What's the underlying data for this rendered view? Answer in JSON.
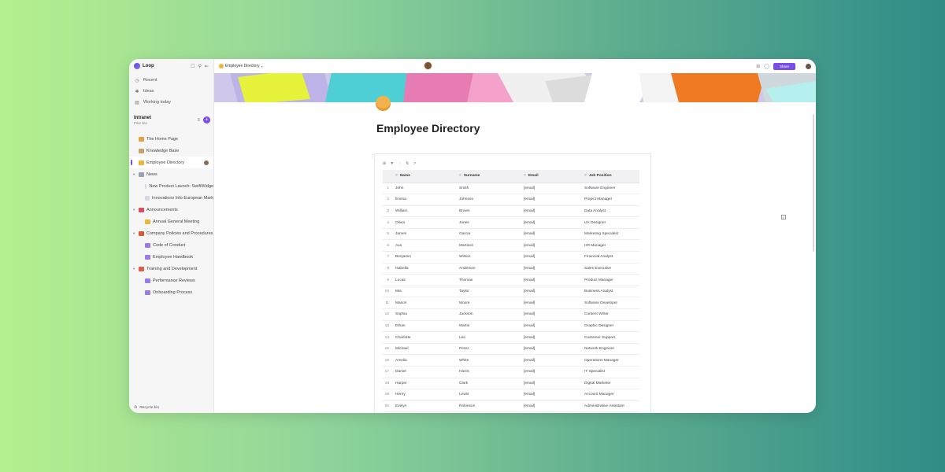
{
  "app": {
    "name": "Loop"
  },
  "sidebar": {
    "nav": [
      {
        "label": "Recent",
        "icon": "clock-icon"
      },
      {
        "label": "Ideas",
        "icon": "lightbulb-icon"
      },
      {
        "label": "Working today",
        "icon": "briefcase-icon"
      }
    ],
    "workspace": {
      "name": "Intranet",
      "sub": "Pilot site"
    },
    "tree": [
      {
        "label": "The Home Page",
        "level": 0,
        "kind": "page",
        "color": "#e2a34a"
      },
      {
        "label": "Knowledge Base",
        "level": 0,
        "kind": "page",
        "color": "#c7a26b"
      },
      {
        "label": "Employee Directory",
        "level": 0,
        "kind": "page",
        "active": true,
        "color": "#f0b43a"
      },
      {
        "label": "News",
        "level": 0,
        "kind": "group",
        "color": "#9aa0b5"
      },
      {
        "label": "New Product Launch: SwiftWidge",
        "level": 1,
        "kind": "page",
        "color": "#d6d6e6"
      },
      {
        "label": "Innovations Into European Mark",
        "level": 1,
        "kind": "page",
        "color": "#d6d6e6"
      },
      {
        "label": "Announcements",
        "level": 0,
        "kind": "group",
        "color": "#d84b64"
      },
      {
        "label": "Annual General Meeting",
        "level": 1,
        "kind": "page",
        "color": "#f0b43a"
      },
      {
        "label": "Company Policies and Procedures",
        "level": 0,
        "kind": "group",
        "color": "#d65a3a"
      },
      {
        "label": "Code of Conduct",
        "level": 1,
        "kind": "page",
        "color": "#9c7be6"
      },
      {
        "label": "Employee Handbook",
        "level": 1,
        "kind": "page",
        "color": "#9c7be6"
      },
      {
        "label": "Training and Development",
        "level": 0,
        "kind": "group",
        "color": "#e25b4b"
      },
      {
        "label": "Performance Reviews",
        "level": 1,
        "kind": "page",
        "color": "#9c7be6"
      },
      {
        "label": "Onboarding Process",
        "level": 1,
        "kind": "page",
        "color": "#9c7be6"
      }
    ],
    "bottom": {
      "label": "Recycle bin",
      "icon": "recycle-bin-icon"
    }
  },
  "topbar": {
    "breadcrumb": "Employee Directory",
    "share_label": "Share"
  },
  "page": {
    "title": "Employee Directory"
  },
  "table": {
    "columns": [
      "Name",
      "Surname",
      "Email",
      "Job Position"
    ],
    "rows": [
      [
        "1",
        "John",
        "Smith",
        "[email]",
        "Software Engineer"
      ],
      [
        "2",
        "Emma",
        "Johnson",
        "[email]",
        "Project Manager"
      ],
      [
        "3",
        "William",
        "Brown",
        "[email]",
        "Data Analyst"
      ],
      [
        "4",
        "Olivia",
        "Jones",
        "[email]",
        "UX Designer"
      ],
      [
        "5",
        "James",
        "Garcia",
        "[email]",
        "Marketing Specialist"
      ],
      [
        "6",
        "Ava",
        "Martinez",
        "[email]",
        "HR Manager"
      ],
      [
        "7",
        "Benjamin",
        "Wilson",
        "[email]",
        "Financial Analyst"
      ],
      [
        "8",
        "Isabella",
        "Anderson",
        "[email]",
        "Sales Executive"
      ],
      [
        "9",
        "Lucas",
        "Thomas",
        "[email]",
        "Product Manager"
      ],
      [
        "10",
        "Mia",
        "Taylor",
        "[email]",
        "Business Analyst"
      ],
      [
        "11",
        "Mason",
        "Moore",
        "[email]",
        "Software Developer"
      ],
      [
        "12",
        "Sophia",
        "Jackson",
        "[email]",
        "Content Writer"
      ],
      [
        "13",
        "Ethan",
        "Martin",
        "[email]",
        "Graphic Designer"
      ],
      [
        "14",
        "Charlotte",
        "Lee",
        "[email]",
        "Customer Support"
      ],
      [
        "15",
        "Michael",
        "Perez",
        "[email]",
        "Network Engineer"
      ],
      [
        "16",
        "Amelia",
        "White",
        "[email]",
        "Operations Manager"
      ],
      [
        "17",
        "Daniel",
        "Harris",
        "[email]",
        "IT Specialist"
      ],
      [
        "18",
        "Harper",
        "Clark",
        "[email]",
        "Digital Marketer"
      ],
      [
        "19",
        "Henry",
        "Lewis",
        "[email]",
        "Account Manager"
      ],
      [
        "20",
        "Evelyn",
        "Robinson",
        "[email]",
        "Administrative Assistant"
      ]
    ]
  },
  "colors": {
    "accent": "#7b4de8",
    "background_start": "#b5f08e",
    "background_end": "#2f8c87"
  }
}
